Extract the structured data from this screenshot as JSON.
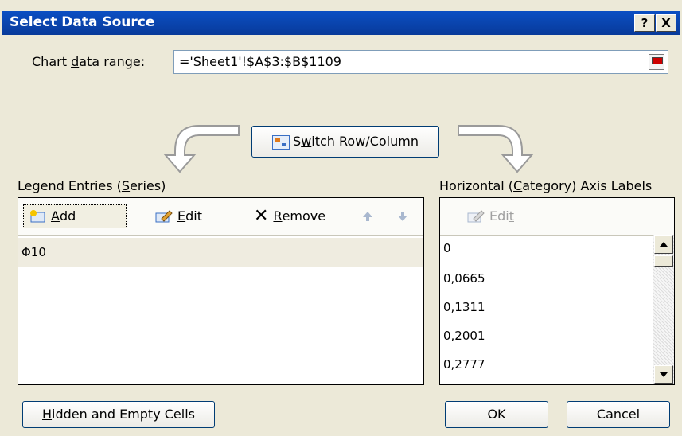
{
  "window": {
    "title": "Select Data Source",
    "help_label": "?",
    "close_label": "X"
  },
  "range": {
    "label_pre": "Chart ",
    "label_ul": "d",
    "label_post": "ata range:",
    "value": "='Sheet1'!$A$3:$B$1109"
  },
  "switch": {
    "label_pre": "S",
    "label_ul": "w",
    "label_post": "itch Row/Column"
  },
  "legend": {
    "title_pre": "Legend Entries (",
    "title_ul": "S",
    "title_post": "eries)",
    "add_ul": "A",
    "add_post": "dd",
    "edit_ul": "E",
    "edit_post": "dit",
    "remove_ul": "R",
    "remove_post": "emove",
    "series": [
      "Φ10"
    ]
  },
  "axis": {
    "title_pre": "Horizontal (",
    "title_ul": "C",
    "title_post": "ategory) Axis Labels",
    "edit_pre": "Edi",
    "edit_ul": "t",
    "labels": [
      "0",
      "0,0665",
      "0,1311",
      "0,2001",
      "0,2777"
    ]
  },
  "footer": {
    "hidden_ul": "H",
    "hidden_post": "idden and Empty Cells",
    "ok_label": "OK",
    "cancel_label": "Cancel"
  },
  "colors": {
    "title_bar": "#0b4fc3",
    "dialog_bg": "#ece9d8",
    "selected_row": "#efece0"
  }
}
